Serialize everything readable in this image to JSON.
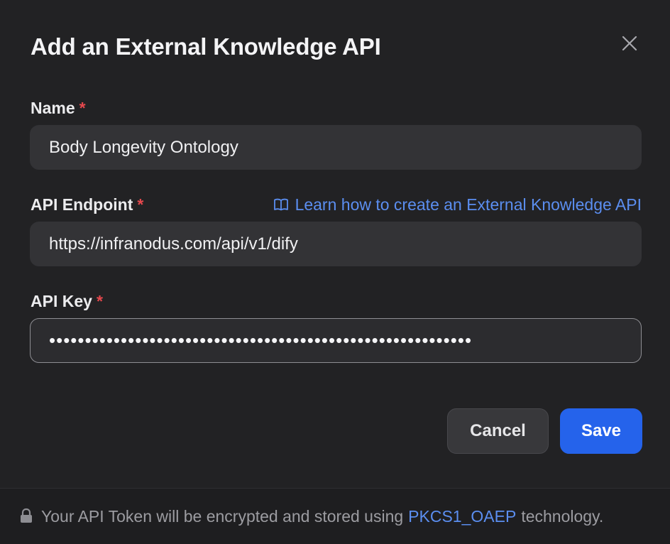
{
  "dialog": {
    "title": "Add an External Knowledge API",
    "close_icon": "close-icon"
  },
  "fields": {
    "name": {
      "label": "Name",
      "required_mark": "*",
      "value": "Body Longevity Ontology"
    },
    "endpoint": {
      "label": "API Endpoint",
      "required_mark": "*",
      "value": "https://infranodus.com/api/v1/dify",
      "help_link": "Learn how to create an External Knowledge API",
      "help_icon": "book-icon"
    },
    "api_key": {
      "label": "API Key",
      "required_mark": "*",
      "value": "•••••••••••••••••••••••••••••••••••••••••••••••••••••••••••"
    }
  },
  "actions": {
    "cancel_label": "Cancel",
    "save_label": "Save"
  },
  "footer": {
    "lock_icon": "lock-icon",
    "text_before": "Your API Token will be encrypted and stored using",
    "link_text": "PKCS1_OAEP",
    "text_after": "technology."
  },
  "colors": {
    "background": "#222224",
    "input_background": "#333336",
    "accent_blue": "#2563eb",
    "link_blue": "#5b8ef0",
    "required_red": "#e5484d"
  }
}
